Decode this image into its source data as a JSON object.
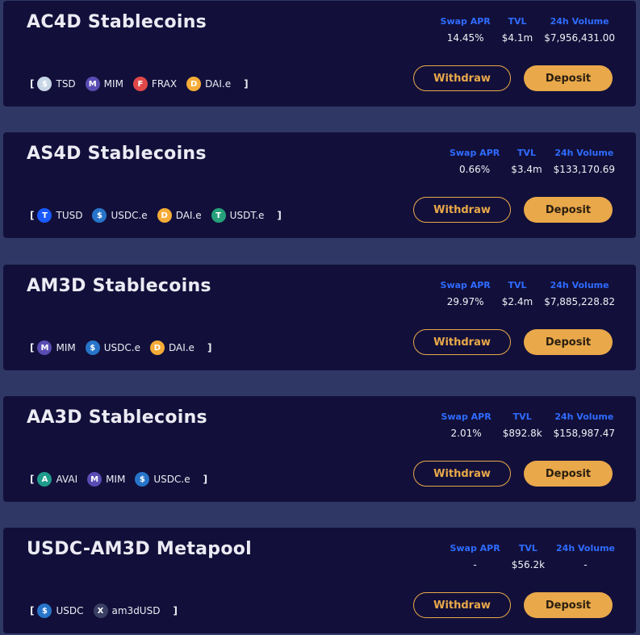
{
  "pools": [
    {
      "title": "AC4D Stablecoins",
      "stats": [
        {
          "label": "Swap APR",
          "value": "14.45%"
        },
        {
          "label": "TVL",
          "value": "$4.1m"
        },
        {
          "label": "24h Volume",
          "value": "$7,956,431.00"
        }
      ],
      "tokens": [
        {
          "symbol": "TSD",
          "icon": "tsd-icon",
          "color": "#c8d6e6",
          "glyph": "$"
        },
        {
          "symbol": "MIM",
          "icon": "mim-icon",
          "color": "#5a4cb3",
          "glyph": "M"
        },
        {
          "symbol": "FRAX",
          "icon": "frax-icon",
          "color": "#e04848",
          "glyph": "F"
        },
        {
          "symbol": "DAI.e",
          "icon": "dai-icon",
          "color": "#f5ac37",
          "glyph": "D"
        }
      ],
      "withdraw_label": "Withdraw",
      "deposit_label": "Deposit"
    },
    {
      "title": "AS4D Stablecoins",
      "stats": [
        {
          "label": "Swap APR",
          "value": "0.66%"
        },
        {
          "label": "TVL",
          "value": "$3.4m"
        },
        {
          "label": "24h Volume",
          "value": "$133,170.69"
        }
      ],
      "tokens": [
        {
          "symbol": "TUSD",
          "icon": "tusd-icon",
          "color": "#1a5aff",
          "glyph": "T"
        },
        {
          "symbol": "USDC.e",
          "icon": "usdc-icon",
          "color": "#2775ca",
          "glyph": "$"
        },
        {
          "symbol": "DAI.e",
          "icon": "dai-icon",
          "color": "#f5ac37",
          "glyph": "D"
        },
        {
          "symbol": "USDT.e",
          "icon": "usdt-icon",
          "color": "#26a17b",
          "glyph": "T"
        }
      ],
      "withdraw_label": "Withdraw",
      "deposit_label": "Deposit"
    },
    {
      "title": "AM3D Stablecoins",
      "stats": [
        {
          "label": "Swap APR",
          "value": "29.97%"
        },
        {
          "label": "TVL",
          "value": "$2.4m"
        },
        {
          "label": "24h Volume",
          "value": "$7,885,228.82"
        }
      ],
      "tokens": [
        {
          "symbol": "MIM",
          "icon": "mim-icon",
          "color": "#5a4cb3",
          "glyph": "M"
        },
        {
          "symbol": "USDC.e",
          "icon": "usdc-icon",
          "color": "#2775ca",
          "glyph": "$"
        },
        {
          "symbol": "DAI.e",
          "icon": "dai-icon",
          "color": "#f5ac37",
          "glyph": "D"
        }
      ],
      "withdraw_label": "Withdraw",
      "deposit_label": "Deposit"
    },
    {
      "title": "AA3D Stablecoins",
      "stats": [
        {
          "label": "Swap APR",
          "value": "2.01%"
        },
        {
          "label": "TVL",
          "value": "$892.8k"
        },
        {
          "label": "24h Volume",
          "value": "$158,987.47"
        }
      ],
      "tokens": [
        {
          "symbol": "AVAI",
          "icon": "avai-icon",
          "color": "#1f9b8c",
          "glyph": "A"
        },
        {
          "symbol": "MIM",
          "icon": "mim-icon",
          "color": "#5a4cb3",
          "glyph": "M"
        },
        {
          "symbol": "USDC.e",
          "icon": "usdc-icon",
          "color": "#2775ca",
          "glyph": "$"
        }
      ],
      "withdraw_label": "Withdraw",
      "deposit_label": "Deposit"
    },
    {
      "title": "USDC-AM3D Metapool",
      "stats": [
        {
          "label": "Swap APR",
          "value": "-"
        },
        {
          "label": "TVL",
          "value": "$56.2k"
        },
        {
          "label": "24h Volume",
          "value": "-"
        }
      ],
      "tokens": [
        {
          "symbol": "USDC",
          "icon": "usdc-icon",
          "color": "#2775ca",
          "glyph": "$"
        },
        {
          "symbol": "am3dUSD",
          "icon": "am3dusd-icon",
          "color": "#3a3f63",
          "glyph": "X"
        }
      ],
      "withdraw_label": "Withdraw",
      "deposit_label": "Deposit"
    }
  ],
  "bracket_open": "[",
  "bracket_close": "]",
  "colors": {
    "background": "#2f3765",
    "card": "#12103a",
    "accent": "#e9a84a",
    "stat_label": "#2f6bff"
  }
}
